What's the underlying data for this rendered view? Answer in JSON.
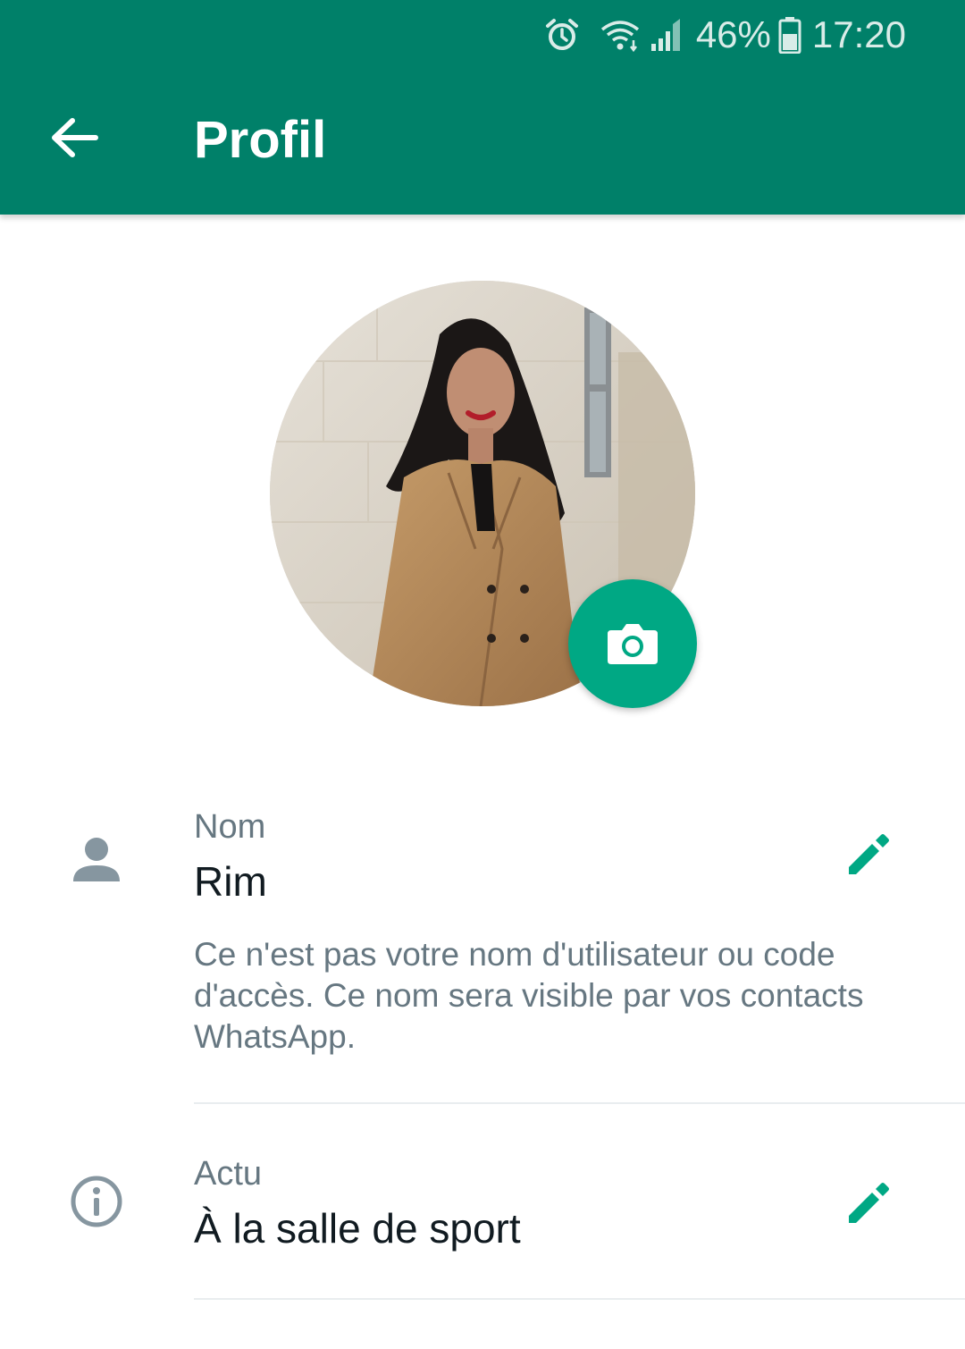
{
  "status_bar": {
    "battery": "46%",
    "time": "17:20",
    "icons": [
      "alarm-icon",
      "wifi-icon",
      "signal-icon",
      "battery-icon"
    ]
  },
  "toolbar": {
    "title": "Profil",
    "back_icon": "arrow-left-icon"
  },
  "profile": {
    "photo_icon": "camera-icon"
  },
  "name_row": {
    "label": "Nom",
    "value": "Rim",
    "hint": "Ce n'est pas votre nom d'utilisateur ou code d'accès. Ce nom sera visible par vos contacts WhatsApp.",
    "icon": "person-icon",
    "edit_icon": "pencil-icon"
  },
  "about_row": {
    "label": "Actu",
    "value": "À la salle de sport",
    "icon": "info-icon",
    "edit_icon": "pencil-icon"
  },
  "colors": {
    "header": "#008069",
    "accent": "#00a884",
    "secondary_text": "#667781",
    "primary_text": "#111b21"
  }
}
